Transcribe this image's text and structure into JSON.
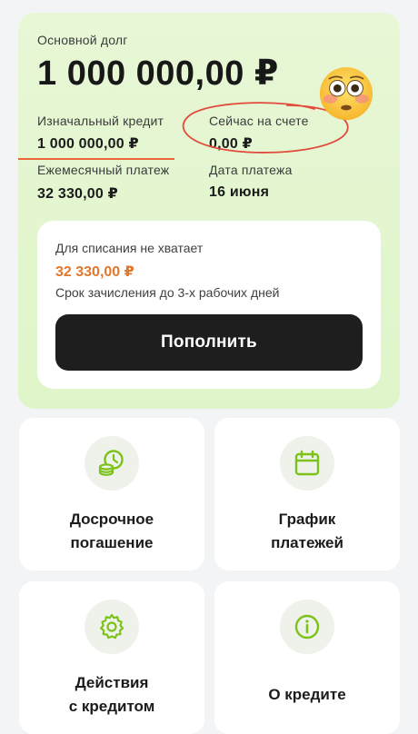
{
  "loan": {
    "principal_label": "Основной долг",
    "principal_amount": "1 000 000,00 ₽",
    "initial_credit_label": "Изначальный кредит",
    "initial_credit_value": "1 000 000,00 ₽",
    "current_account_label": "Сейчас на счете",
    "current_account_value": "0,00 ₽",
    "monthly_payment_label": "Ежемесячный платеж",
    "monthly_payment_value": "32 330,00 ₽",
    "payment_date_label": "Дата платежа",
    "payment_date_value": "16 июня"
  },
  "topup": {
    "shortfall_label": "Для списания не хватает",
    "shortfall_amount": "32 330,00 ₽",
    "credit_term_text": "Срок зачисления до 3-х рабочих дней",
    "button_label": "Пополнить"
  },
  "actions": [
    {
      "line1": "Досрочное",
      "line2": "погашение",
      "icon": "early-repayment-icon"
    },
    {
      "line1": "График",
      "line2": "платежей",
      "icon": "calendar-icon"
    },
    {
      "line1": "Действия",
      "line2": "с кредитом",
      "icon": "gear-icon"
    },
    {
      "line1": "О кредите",
      "icon": "info-icon"
    }
  ],
  "colors": {
    "card_bg": "#e3f6cf",
    "accent_green": "#7cc21b",
    "shortfall_orange": "#e0772b",
    "annotation_red": "#e24a3b",
    "button_dark": "#1e1e1e"
  }
}
